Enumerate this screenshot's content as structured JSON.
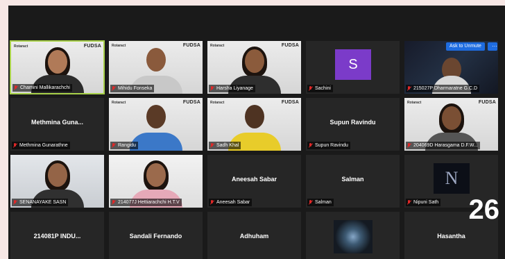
{
  "colors": {
    "accent_active_border": "#a9d24a",
    "muted_icon": "#e02828",
    "avatar_s": "#7b3bc9",
    "unmute_button": "#1e6ce0"
  },
  "branding": {
    "left_logo": "Rotaract",
    "right_logo": "FUDSA"
  },
  "controls": {
    "ask_to_unmute": "Ask to Unmute",
    "more": "···"
  },
  "page_number": "26",
  "participants": [
    {
      "label": "Chamini Mallikarachchi"
    },
    {
      "label": "Mihidu Fonseka"
    },
    {
      "label": "Harsha Liyanage"
    },
    {
      "label": "Sachini",
      "avatar": "S"
    },
    {
      "label": "215027P Dharmaratne G.C.D"
    },
    {
      "label": "Methmina Gunarathne",
      "center": "Methmina Guna..."
    },
    {
      "label": "Rangidu"
    },
    {
      "label": "Sadh Khal"
    },
    {
      "label": "Supun Ravindu",
      "center": "Supun Ravindu"
    },
    {
      "label": "204069D Harasgama D.F.W..."
    },
    {
      "label": "SENANAYAKE SASN"
    },
    {
      "label": "214077J Hettiarachchi H.T.V"
    },
    {
      "label": "Aneesah Sabar",
      "center": "Aneesah Sabar"
    },
    {
      "label": "Salman",
      "center": "Salman"
    },
    {
      "label": "Nipuni Sath",
      "avatar": "N"
    },
    {
      "center": "214081P INDU..."
    },
    {
      "center": "Sandali Fernando"
    },
    {
      "center": "Adhuham"
    },
    {},
    {
      "center": "Hasantha"
    }
  ]
}
